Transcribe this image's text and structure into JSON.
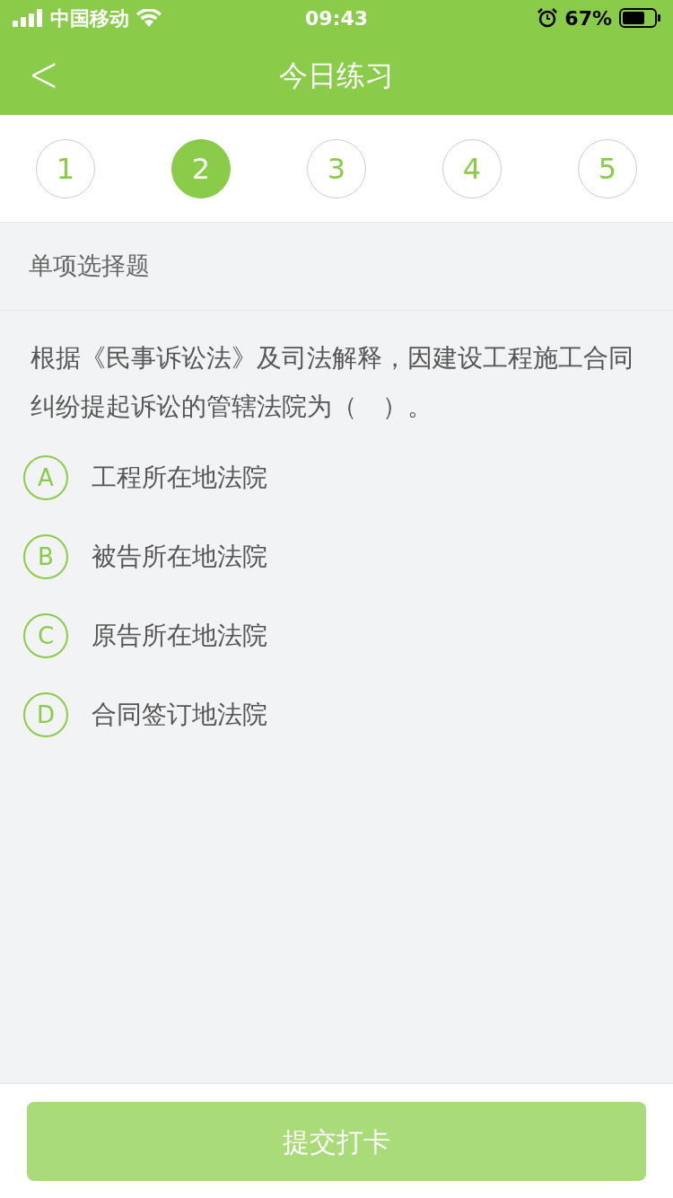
{
  "status_bar": {
    "carrier": "中国移动",
    "time": "09:43",
    "battery": "67%"
  },
  "nav": {
    "back": "<",
    "title": "今日练习"
  },
  "question_numbers": [
    {
      "label": "1",
      "selected": false
    },
    {
      "label": "2",
      "selected": true
    },
    {
      "label": "3",
      "selected": false
    },
    {
      "label": "4",
      "selected": false
    },
    {
      "label": "5",
      "selected": false
    }
  ],
  "section_title": "单项选择题",
  "question": "根据《民事诉讼法》及司法解释，因建设工程施工合同纠纷提起诉讼的管辖法院为（　）。",
  "options": [
    {
      "letter": "A",
      "text": "工程所在地法院",
      "selected": false
    },
    {
      "letter": "B",
      "text": "被告所在地法院",
      "selected": false
    },
    {
      "letter": "C",
      "text": "原告所在地法院",
      "selected": false
    },
    {
      "letter": "D",
      "text": "合同签订地法院",
      "selected": false
    }
  ],
  "submit": {
    "label": "提交打卡",
    "disabled": true
  }
}
